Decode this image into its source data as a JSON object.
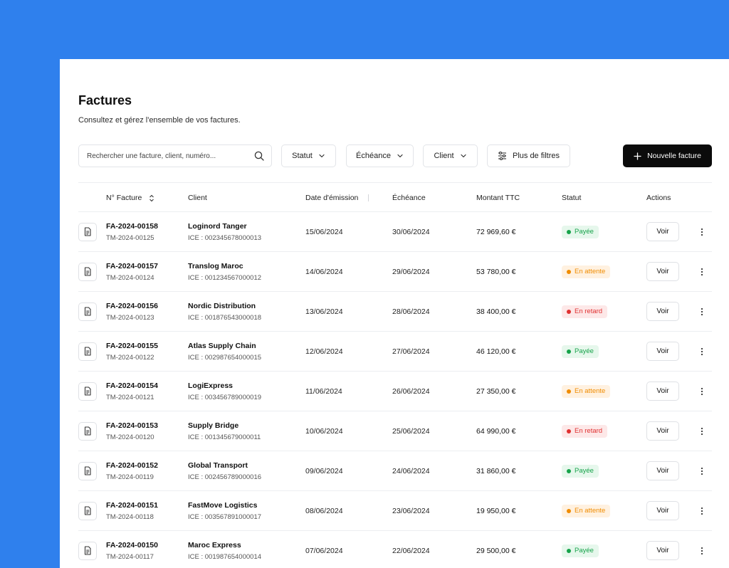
{
  "header": {
    "title": "Factures",
    "subtitle": "Consultez et gérez l'ensemble de vos factures."
  },
  "toolbar": {
    "search_placeholder": "Rechercher une facture, client, numéro...",
    "filter_statut": "Statut",
    "filter_echeance": "Échéance",
    "filter_client": "Client",
    "more_filters": "Plus de filtres",
    "new_invoice": "Nouvelle facture"
  },
  "icons": {
    "search": "search-icon",
    "chevron": "chevron-down-icon",
    "sliders": "sliders-icon",
    "plus": "plus-icon",
    "document": "document-icon",
    "sort": "sort-icon",
    "kebab": "more-vertical-icon"
  },
  "table": {
    "columns": {
      "invoice": "N° Facture",
      "client": "Client",
      "issue_date": "Date d'émission",
      "due_date": "Échéance",
      "amount": "Montant TTC",
      "status": "Statut",
      "actions": "Actions"
    },
    "view_label": "Voir",
    "rows": [
      {
        "invoice": "FA-2024-00158",
        "ref": "TM-2024-00125",
        "client": "Loginord Tanger",
        "ice": "ICE : 002345678000013",
        "issue": "15/06/2024",
        "due": "30/06/2024",
        "amount": "72 969,60 €",
        "status": "Payée",
        "status_key": "paid"
      },
      {
        "invoice": "FA-2024-00157",
        "ref": "TM-2024-00124",
        "client": "Translog Maroc",
        "ice": "ICE : 001234567000012",
        "issue": "14/06/2024",
        "due": "29/06/2024",
        "amount": "53 780,00 €",
        "status": "En attente",
        "status_key": "pending"
      },
      {
        "invoice": "FA-2024-00156",
        "ref": "TM-2024-00123",
        "client": "Nordic Distribution",
        "ice": "ICE : 001876543000018",
        "issue": "13/06/2024",
        "due": "28/06/2024",
        "amount": "38 400,00 €",
        "status": "En retard",
        "status_key": "late"
      },
      {
        "invoice": "FA-2024-00155",
        "ref": "TM-2024-00122",
        "client": "Atlas Supply Chain",
        "ice": "ICE : 002987654000015",
        "issue": "12/06/2024",
        "due": "27/06/2024",
        "amount": "46 120,00 €",
        "status": "Payée",
        "status_key": "paid"
      },
      {
        "invoice": "FA-2024-00154",
        "ref": "TM-2024-00121",
        "client": "LogiExpress",
        "ice": "ICE : 003456789000019",
        "issue": "11/06/2024",
        "due": "26/06/2024",
        "amount": "27 350,00 €",
        "status": "En attente",
        "status_key": "pending"
      },
      {
        "invoice": "FA-2024-00153",
        "ref": "TM-2024-00120",
        "client": "Supply Bridge",
        "ice": "ICE : 001345679000011",
        "issue": "10/06/2024",
        "due": "25/06/2024",
        "amount": "64 990,00 €",
        "status": "En retard",
        "status_key": "late"
      },
      {
        "invoice": "FA-2024-00152",
        "ref": "TM-2024-00119",
        "client": "Global Transport",
        "ice": "ICE : 002456789000016",
        "issue": "09/06/2024",
        "due": "24/06/2024",
        "amount": "31 860,00 €",
        "status": "Payée",
        "status_key": "paid"
      },
      {
        "invoice": "FA-2024-00151",
        "ref": "TM-2024-00118",
        "client": "FastMove Logistics",
        "ice": "ICE : 003567891000017",
        "issue": "08/06/2024",
        "due": "23/06/2024",
        "amount": "19 950,00 €",
        "status": "En attente",
        "status_key": "pending"
      },
      {
        "invoice": "FA-2024-00150",
        "ref": "TM-2024-00117",
        "client": "Maroc Express",
        "ice": "ICE : 001987654000014",
        "issue": "07/06/2024",
        "due": "22/06/2024",
        "amount": "29 500,00 €",
        "status": "Payée",
        "status_key": "paid"
      }
    ]
  },
  "colors": {
    "background": "#2f80ed",
    "primary_button": "#0b0b0b",
    "paid_bg": "#e6f7ec",
    "paid_text": "#16a34a",
    "pending_bg": "#fff1e0",
    "pending_text": "#f08c00",
    "late_bg": "#fde8e8",
    "late_text": "#e03131"
  }
}
